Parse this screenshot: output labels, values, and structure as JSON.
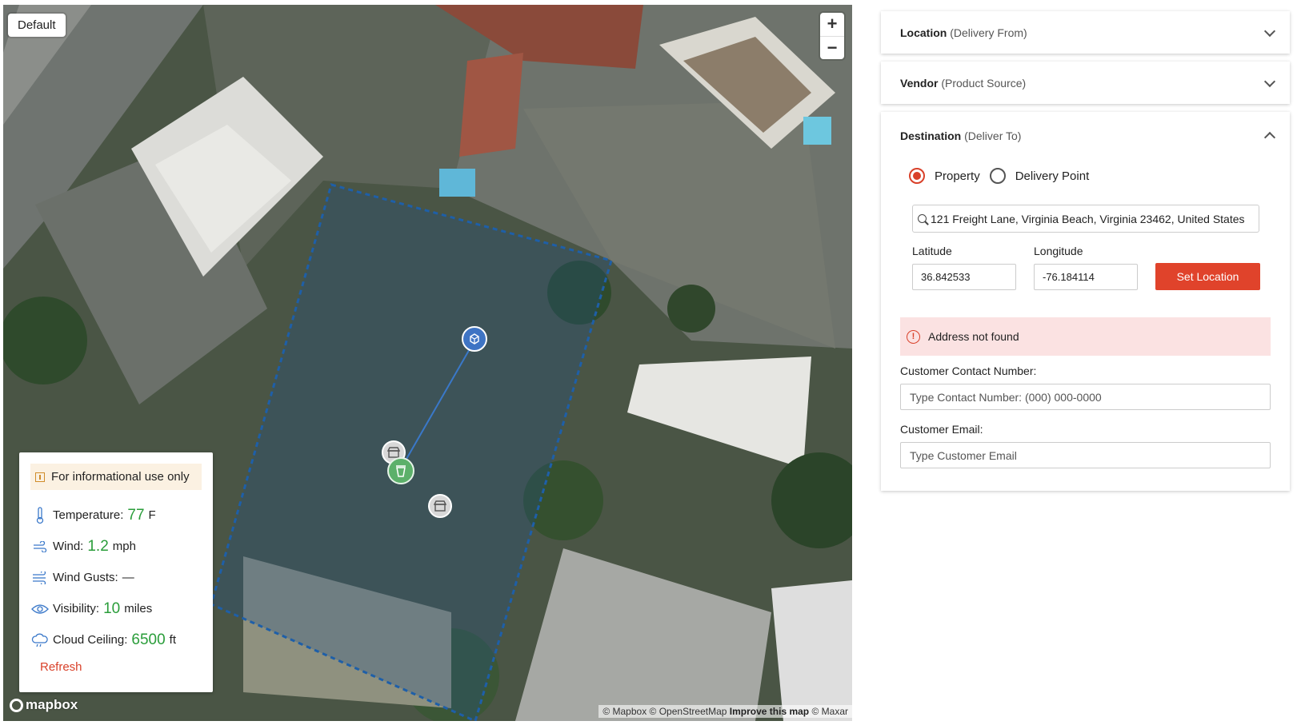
{
  "map": {
    "style_label": "Default",
    "zoom_in": "+",
    "zoom_out": "−",
    "logo_text": "mapbox",
    "attribution": {
      "mapbox": "© Mapbox",
      "osm": "© OpenStreetMap",
      "improve": "Improve this map",
      "maxar": "© Maxar"
    }
  },
  "weather": {
    "note": "For informational use only",
    "rows": [
      {
        "label": "Temperature:",
        "value": "77",
        "unit": "F",
        "icon": "thermometer-icon"
      },
      {
        "label": "Wind:",
        "value": "1.2",
        "unit": "mph",
        "icon": "wind-icon"
      },
      {
        "label": "Wind Gusts:",
        "value": "—",
        "unit": "",
        "icon": "wind-gusts-icon"
      },
      {
        "label": "Visibility:",
        "value": "10",
        "unit": "miles",
        "icon": "eye-icon"
      },
      {
        "label": "Cloud Ceiling:",
        "value": "6500",
        "unit": "ft",
        "icon": "cloud-icon"
      }
    ],
    "refresh": "Refresh",
    "value_color": "#2a9d3a"
  },
  "panel": {
    "location": {
      "title": "Location",
      "subtitle": "(Delivery From)"
    },
    "vendor": {
      "title": "Vendor",
      "subtitle": "(Product Source)"
    },
    "destination": {
      "title": "Destination",
      "subtitle": "(Deliver To)",
      "radio_property": "Property",
      "radio_delivery_point": "Delivery Point",
      "selected": "Property",
      "address": "121 Freight Lane, Virginia Beach, Virginia 23462, United States",
      "latitude_label": "Latitude",
      "latitude": "36.842533",
      "longitude_label": "Longitude",
      "longitude": "-76.184114",
      "set_location": "Set Location",
      "error": "Address not found",
      "contact_label": "Customer Contact Number:",
      "contact_placeholder": "Type Contact Number: (000) 000-0000",
      "email_label": "Customer Email:",
      "email_placeholder": "Type Customer Email"
    }
  },
  "colors": {
    "accent": "#e0432b",
    "error_bg": "#fbe2e2",
    "note_bg": "#fbf1e2",
    "boundary": "#1e5fa8"
  }
}
